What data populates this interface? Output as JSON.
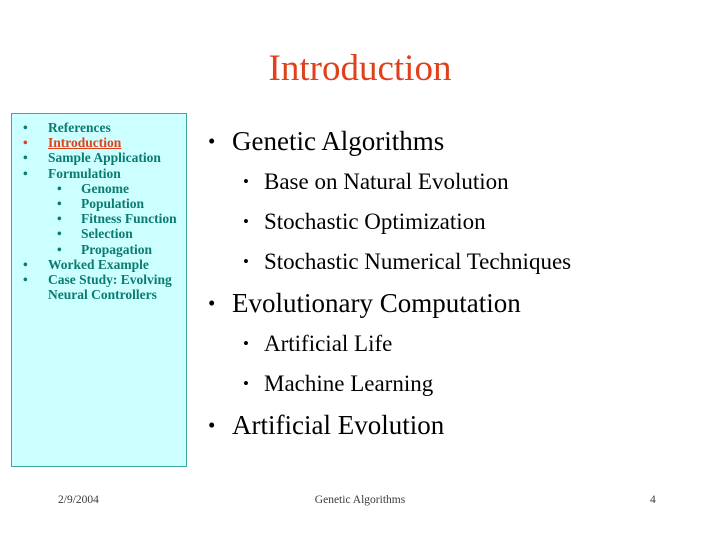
{
  "slide": {
    "title": "Introduction",
    "title_color": "#E0411B",
    "background_color": "#FFFFFF"
  },
  "sidebar": {
    "background_color": "#CCFFFF",
    "border_color": "#3BA99C",
    "text_color": "#0B7B72",
    "active_color": "#E0411B",
    "bullet_glyph": "•",
    "items": [
      {
        "label": "References",
        "level": 1,
        "active": false
      },
      {
        "label": "Introduction",
        "level": 1,
        "active": true
      },
      {
        "label": "Sample Application",
        "level": 1,
        "active": false
      },
      {
        "label": "Formulation",
        "level": 1,
        "active": false
      },
      {
        "label": "Genome",
        "level": 2,
        "active": false
      },
      {
        "label": "Population",
        "level": 2,
        "active": false
      },
      {
        "label": "Fitness Function",
        "level": 2,
        "active": false
      },
      {
        "label": "Selection",
        "level": 2,
        "active": false
      },
      {
        "label": "Propagation",
        "level": 2,
        "active": false
      },
      {
        "label": "Worked Example",
        "level": 1,
        "active": false
      },
      {
        "label": "Case Study: Evolving Neural Controllers",
        "level": 1,
        "active": false
      }
    ]
  },
  "body": {
    "text_color": "#000000",
    "bullet_glyph": "•",
    "lines": [
      {
        "text": "Genetic Algorithms",
        "level": 1
      },
      {
        "text": "Base on Natural Evolution",
        "level": 2
      },
      {
        "text": "Stochastic Optimization",
        "level": 2
      },
      {
        "text": "Stochastic Numerical Techniques",
        "level": 2
      },
      {
        "text": "Evolutionary Computation",
        "level": 1
      },
      {
        "text": "Artificial Life",
        "level": 2
      },
      {
        "text": "Machine Learning",
        "level": 2
      },
      {
        "text": "Artificial Evolution",
        "level": 1
      }
    ]
  },
  "footer": {
    "date": "2/9/2004",
    "center": "Genetic Algorithms",
    "page_number": "4"
  }
}
